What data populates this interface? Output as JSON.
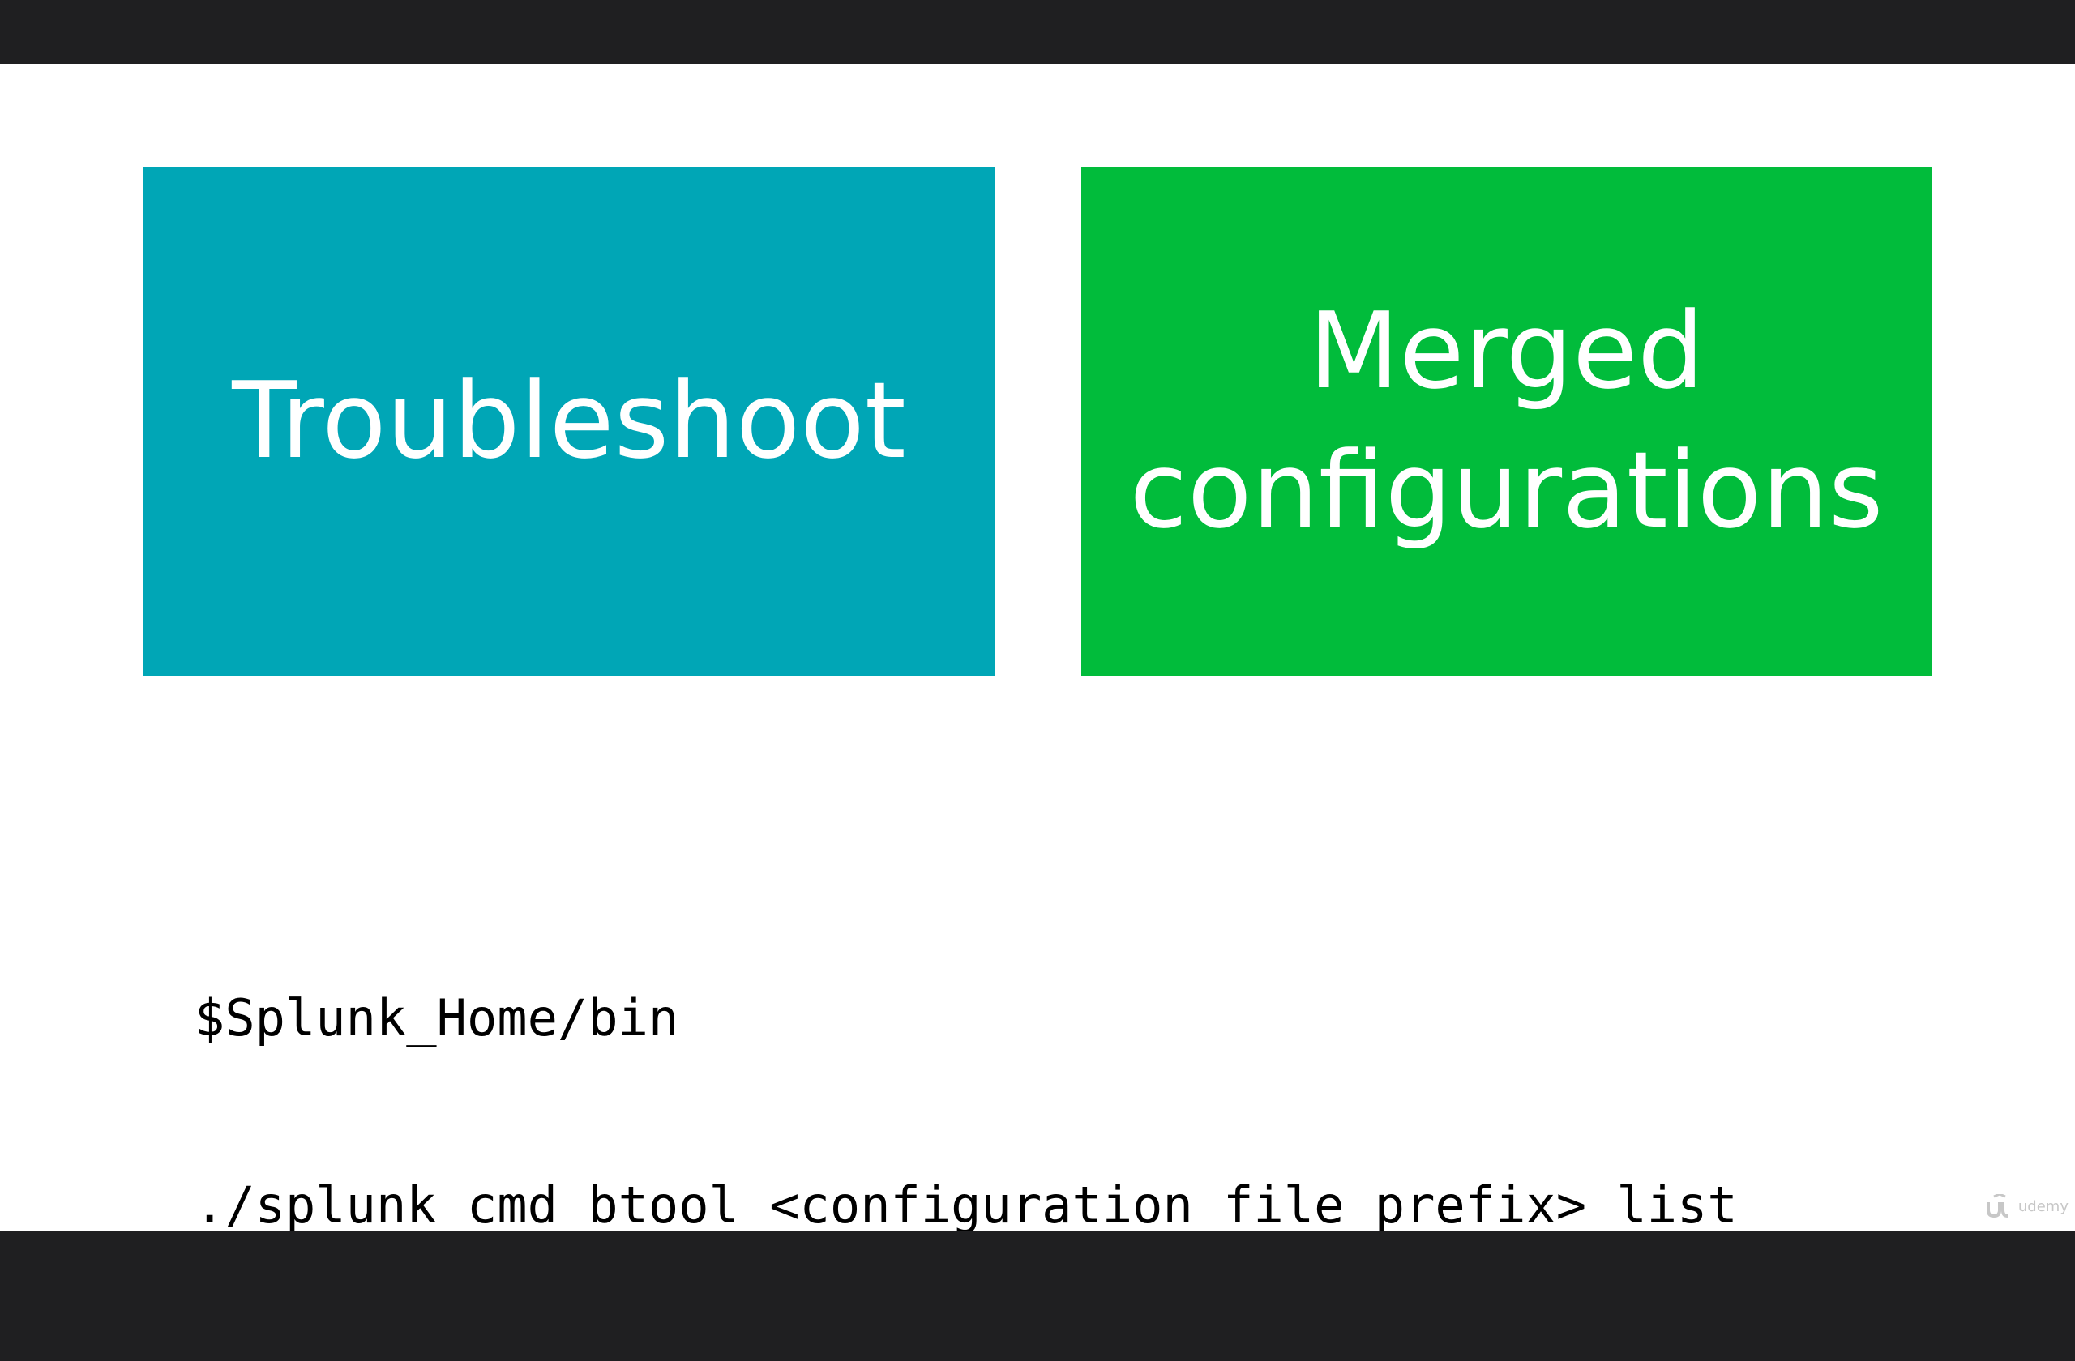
{
  "slide": {
    "tiles": [
      {
        "label": "Troubleshoot",
        "color": "#00a6b6"
      },
      {
        "label": "Merged\nconfigurations",
        "color": "#01bc3b"
      }
    ],
    "code_lines": [
      "$Splunk_Home/bin",
      "./splunk cmd btool <configuration file prefix> list"
    ]
  },
  "watermark": {
    "icon": "udemy-logo-icon",
    "text": "udemy"
  }
}
